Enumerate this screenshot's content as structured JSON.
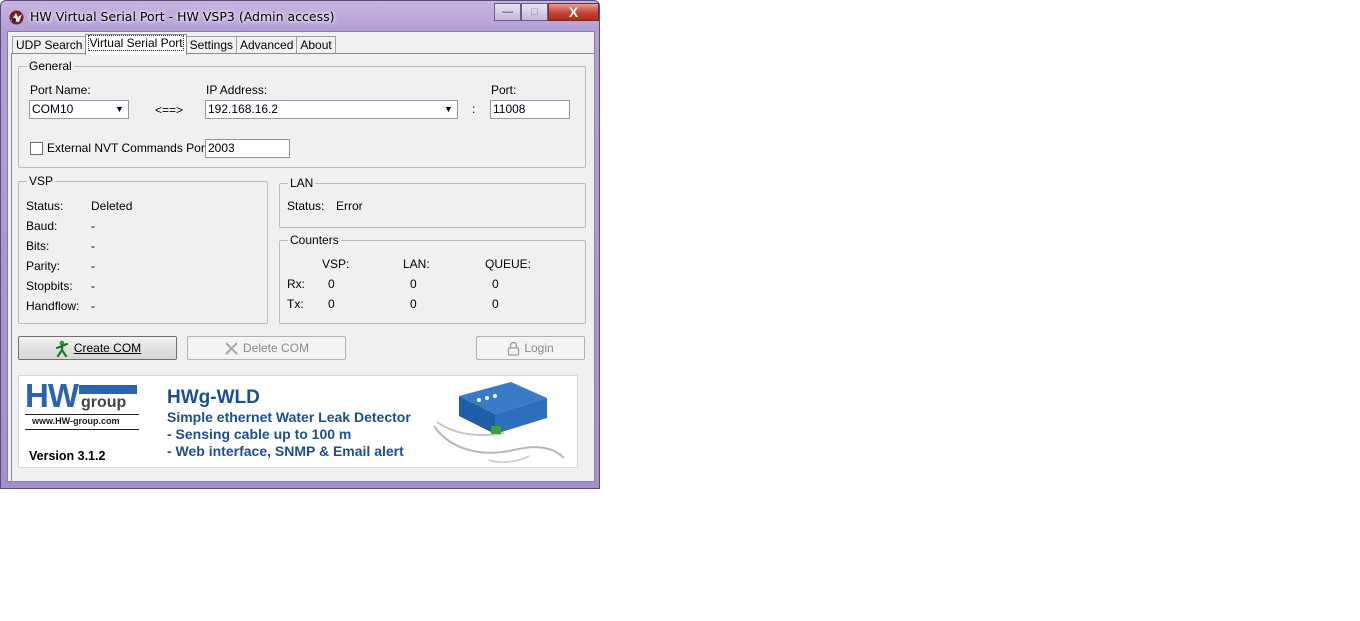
{
  "window": {
    "title": "HW Virtual Serial Port - HW VSP3 (Admin access)"
  },
  "caption_buttons": {
    "minimize": "—",
    "maximize": "□",
    "close": "X"
  },
  "tabs": [
    {
      "label": "UDP Search"
    },
    {
      "label": "Virtual Serial Port"
    },
    {
      "label": "Settings"
    },
    {
      "label": "Advanced"
    },
    {
      "label": "About"
    }
  ],
  "general": {
    "title": "General",
    "port_name_label": "Port Name:",
    "port_name_value": "COM10",
    "arrow_text": "<==>",
    "ip_label": "IP Address:",
    "ip_value": "192.168.16.2",
    "colon": ":",
    "port_label": "Port:",
    "port_value": "11008",
    "nvt_label": "External NVT Commands Port:",
    "nvt_value": "2003",
    "nvt_checked": false
  },
  "vsp": {
    "title": "VSP",
    "rows": [
      {
        "label": "Status:",
        "value": "Deleted"
      },
      {
        "label": "Baud:",
        "value": "-"
      },
      {
        "label": "Bits:",
        "value": "-"
      },
      {
        "label": "Parity:",
        "value": "-"
      },
      {
        "label": "Stopbits:",
        "value": "-"
      },
      {
        "label": "Handflow:",
        "value": "-"
      }
    ]
  },
  "lan": {
    "title": "LAN",
    "status_label": "Status:",
    "status_value": "Error"
  },
  "counters": {
    "title": "Counters",
    "headers": [
      "VSP:",
      "LAN:",
      "QUEUE:"
    ],
    "rx_label": "Rx:",
    "tx_label": "Tx:",
    "rx": [
      "0",
      "0",
      "0"
    ],
    "tx": [
      "0",
      "0",
      "0"
    ]
  },
  "buttons": {
    "create": "Create COM",
    "delete": "Delete COM",
    "login": "Login"
  },
  "banner": {
    "logo_hw": "HW",
    "logo_group": "group",
    "logo_url": "www.HW-group.com",
    "version": "Version  3.1.2",
    "title": "HWg-WLD",
    "line1": "Simple ethernet Water Leak Detector",
    "line2": " - Sensing cable up to 100 m",
    "line3": " - Web interface, SNMP & Email alert"
  },
  "colors": {
    "banner_blue": "#1b4f8f",
    "logo_blue": "#2a63b0"
  }
}
